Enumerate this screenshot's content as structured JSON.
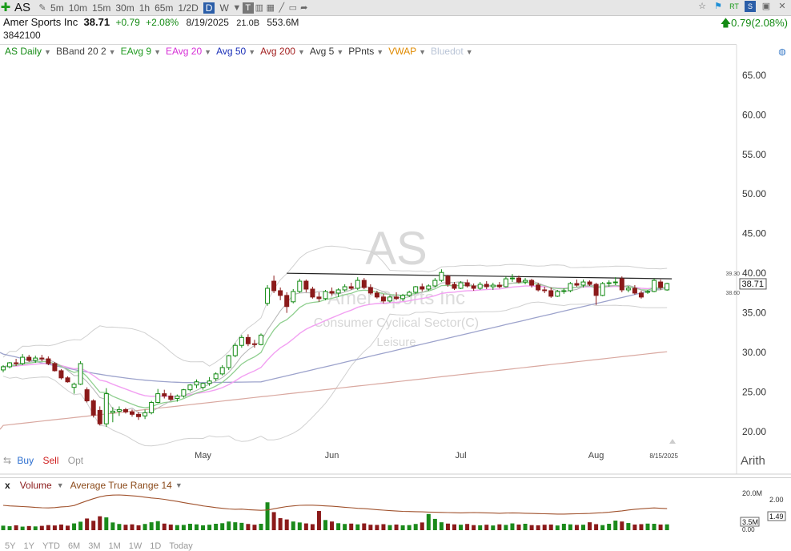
{
  "toolbar": {
    "ticker": "AS",
    "intervals": [
      "5m",
      "10m",
      "15m",
      "30m",
      "1h",
      "65m",
      "1/2D",
      "D",
      "W"
    ],
    "active_interval": "D"
  },
  "quote": {
    "name": "Amer Sports Inc",
    "price": "38.71",
    "change": "+0.79",
    "change_pct": "+2.08%",
    "date": "8/19/2025",
    "market_cap": "21.0B",
    "volume_avg": "553.6M",
    "volume": "3842100",
    "change_summary": "0.79(2.08%)"
  },
  "studies": [
    {
      "label": "AS Daily",
      "color": "#138a13"
    },
    {
      "label": "BBand 20 2",
      "color": "#444444"
    },
    {
      "label": "EAvg 9",
      "color": "#1f9a1f"
    },
    {
      "label": "EAvg 20",
      "color": "#d62fd6"
    },
    {
      "label": "Avg 50",
      "color": "#1a2fb8"
    },
    {
      "label": "Avg 200",
      "color": "#a32020"
    },
    {
      "label": "Avg 5",
      "color": "#333333"
    },
    {
      "label": "PPnts",
      "color": "#333333"
    },
    {
      "label": "VWAP",
      "color": "#e08a00"
    },
    {
      "label": "Bluedot",
      "color": "#b9c4d6"
    }
  ],
  "watermark": {
    "symbol": "AS",
    "name": "Amer Sports Inc",
    "sector": "Consumer Cyclical Sector(C)",
    "industry": "Leisure"
  },
  "trade": {
    "buy": "Buy",
    "sell": "Sell",
    "opt": "Opt"
  },
  "scale_mode": "Arith",
  "lower_pane": {
    "close": "x",
    "study1": "Volume",
    "study2": "Average True Range 14"
  },
  "bottom_labels": [
    "5Y",
    "1Y",
    "YTD",
    "6M",
    "3M",
    "1M",
    "1W",
    "1D",
    "Today"
  ],
  "colors": {
    "up": "#138a13",
    "down": "#8b1a1a"
  },
  "chart_data": {
    "type": "candlestick",
    "title": "AS Daily",
    "ylim": [
      19,
      67
    ],
    "y_ticks": [
      "65.00",
      "60.00",
      "55.00",
      "50.00",
      "45.00",
      "40.00",
      "35.00",
      "30.00",
      "25.00",
      "20.00"
    ],
    "x_labels": [
      "May",
      "Jun",
      "Jul",
      "Aug",
      "8/15/2025"
    ],
    "price_tag": "38.71",
    "price_tag_hi": "39.30",
    "price_tag_lo": "38.60",
    "resistance_line": [
      40.0,
      39.3
    ],
    "candles": [
      [
        27.8,
        28.4,
        27.5,
        28.2
      ],
      [
        28.2,
        28.8,
        28.0,
        28.7
      ],
      [
        28.7,
        29.2,
        28.3,
        28.6
      ],
      [
        28.6,
        29.8,
        28.4,
        29.4
      ],
      [
        29.4,
        29.7,
        28.8,
        29.0
      ],
      [
        29.0,
        29.6,
        28.7,
        29.3
      ],
      [
        29.3,
        29.7,
        28.9,
        29.2
      ],
      [
        29.2,
        29.5,
        28.4,
        28.6
      ],
      [
        28.6,
        28.8,
        27.6,
        27.7
      ],
      [
        27.7,
        27.9,
        26.6,
        26.8
      ],
      [
        26.8,
        27.0,
        26.2,
        26.3
      ],
      [
        25.6,
        26.2,
        24.8,
        26.0
      ],
      [
        26.0,
        28.9,
        25.9,
        28.6
      ],
      [
        25.3,
        25.6,
        23.7,
        23.9
      ],
      [
        23.9,
        24.1,
        21.8,
        22.1
      ],
      [
        22.7,
        23.2,
        20.8,
        21.0
      ],
      [
        21.0,
        25.5,
        20.6,
        24.8
      ],
      [
        22.4,
        23.1,
        21.2,
        22.6
      ],
      [
        22.6,
        23.2,
        22.0,
        22.8
      ],
      [
        22.8,
        23.0,
        22.3,
        22.5
      ],
      [
        22.5,
        22.8,
        21.9,
        22.2
      ],
      [
        22.2,
        22.5,
        21.5,
        21.9
      ],
      [
        22.0,
        22.8,
        21.6,
        22.4
      ],
      [
        22.4,
        23.9,
        22.2,
        23.7
      ],
      [
        23.7,
        25.4,
        23.6,
        24.8
      ],
      [
        24.8,
        25.3,
        24.2,
        24.5
      ],
      [
        24.5,
        24.9,
        23.9,
        24.1
      ],
      [
        24.2,
        24.7,
        23.8,
        24.5
      ],
      [
        24.5,
        25.4,
        24.3,
        25.3
      ],
      [
        25.3,
        26.0,
        25.1,
        25.9
      ],
      [
        25.9,
        26.6,
        25.5,
        26.3
      ],
      [
        25.6,
        26.2,
        25.3,
        26.1
      ],
      [
        26.1,
        26.9,
        25.8,
        26.4
      ],
      [
        26.7,
        27.5,
        26.4,
        27.3
      ],
      [
        27.3,
        28.4,
        27.1,
        28.1
      ],
      [
        28.1,
        29.7,
        27.8,
        29.6
      ],
      [
        29.6,
        31.2,
        29.4,
        30.9
      ],
      [
        30.9,
        32.2,
        30.6,
        31.9
      ],
      [
        31.9,
        32.3,
        30.8,
        31.1
      ],
      [
        31.1,
        31.6,
        30.6,
        31.0
      ],
      [
        31.0,
        32.4,
        30.9,
        32.2
      ],
      [
        36.2,
        38.5,
        35.9,
        38.1
      ],
      [
        39.0,
        39.7,
        37.5,
        37.8
      ],
      [
        37.8,
        38.2,
        36.6,
        37.2
      ],
      [
        37.2,
        37.6,
        35.0,
        35.8
      ],
      [
        36.4,
        38.0,
        36.2,
        37.7
      ],
      [
        37.7,
        39.3,
        37.5,
        39.0
      ],
      [
        39.0,
        39.2,
        37.6,
        38.0
      ],
      [
        38.0,
        38.3,
        36.8,
        37.0
      ],
      [
        37.0,
        37.6,
        36.4,
        36.8
      ],
      [
        36.8,
        37.9,
        36.6,
        37.7
      ],
      [
        37.7,
        38.2,
        37.2,
        37.5
      ],
      [
        37.5,
        38.1,
        37.0,
        37.9
      ],
      [
        37.9,
        38.6,
        37.7,
        38.3
      ],
      [
        38.3,
        38.8,
        37.9,
        38.1
      ],
      [
        38.1,
        39.5,
        37.9,
        39.1
      ],
      [
        39.1,
        39.4,
        38.0,
        38.2
      ],
      [
        38.2,
        38.6,
        37.3,
        37.5
      ],
      [
        37.5,
        37.8,
        36.8,
        37.0
      ],
      [
        37.0,
        37.4,
        36.2,
        36.5
      ],
      [
        36.5,
        37.2,
        36.3,
        37.0
      ],
      [
        37.0,
        37.6,
        36.6,
        36.8
      ],
      [
        36.8,
        37.4,
        36.5,
        37.2
      ],
      [
        37.2,
        37.8,
        37.0,
        37.6
      ],
      [
        37.6,
        38.4,
        37.4,
        38.3
      ],
      [
        38.3,
        38.7,
        37.7,
        38.0
      ],
      [
        38.0,
        38.6,
        37.8,
        38.4
      ],
      [
        38.4,
        39.4,
        38.2,
        39.1
      ],
      [
        39.1,
        40.5,
        38.9,
        40.1
      ],
      [
        39.6,
        39.8,
        38.3,
        38.6
      ],
      [
        38.6,
        38.9,
        37.9,
        38.1
      ],
      [
        38.1,
        39.0,
        38.0,
        38.8
      ],
      [
        38.8,
        39.2,
        38.2,
        38.4
      ],
      [
        38.4,
        38.7,
        37.8,
        38.1
      ],
      [
        38.1,
        38.9,
        37.9,
        38.6
      ],
      [
        38.6,
        39.0,
        38.0,
        38.3
      ],
      [
        38.3,
        38.8,
        37.9,
        38.5
      ],
      [
        38.5,
        38.9,
        38.1,
        38.3
      ],
      [
        38.3,
        39.6,
        38.2,
        39.3
      ],
      [
        39.3,
        39.9,
        38.9,
        39.4
      ],
      [
        39.4,
        39.7,
        38.7,
        38.9
      ],
      [
        38.9,
        39.4,
        38.6,
        39.1
      ],
      [
        39.1,
        39.3,
        38.2,
        38.5
      ],
      [
        38.5,
        38.8,
        37.7,
        37.9
      ],
      [
        37.9,
        38.3,
        37.5,
        37.8
      ],
      [
        37.8,
        38.2,
        36.9,
        37.1
      ],
      [
        37.1,
        37.9,
        37.0,
        37.7
      ],
      [
        37.7,
        38.1,
        37.4,
        37.8
      ],
      [
        37.8,
        38.9,
        37.6,
        38.7
      ],
      [
        38.7,
        39.2,
        38.3,
        38.5
      ],
      [
        38.5,
        39.2,
        38.2,
        38.9
      ],
      [
        38.9,
        39.1,
        38.4,
        38.6
      ],
      [
        38.6,
        38.8,
        36.0,
        37.2
      ],
      [
        37.2,
        38.9,
        37.1,
        38.7
      ],
      [
        38.7,
        39.1,
        38.3,
        38.8
      ],
      [
        38.8,
        39.5,
        38.5,
        38.9
      ],
      [
        39.3,
        39.6,
        37.6,
        37.9
      ],
      [
        37.9,
        38.4,
        37.6,
        38.1
      ],
      [
        38.1,
        38.5,
        37.3,
        37.5
      ],
      [
        37.5,
        37.8,
        36.8,
        37.0
      ],
      [
        37.6,
        37.9,
        37.4,
        37.7
      ],
      [
        37.7,
        39.3,
        37.6,
        39.1
      ],
      [
        38.9,
        39.2,
        37.9,
        38.2
      ],
      [
        37.9,
        38.8,
        37.8,
        38.7
      ]
    ],
    "volume": [
      2.4,
      2.1,
      2.6,
      1.9,
      2.2,
      2.0,
      2.3,
      2.7,
      2.5,
      3.0,
      2.4,
      3.6,
      4.5,
      6.2,
      5.0,
      7.4,
      6.8,
      4.1,
      3.3,
      2.9,
      3.1,
      2.6,
      3.3,
      4.2,
      4.8,
      3.5,
      3.0,
      2.7,
      2.8,
      3.4,
      3.1,
      2.6,
      2.9,
      3.4,
      3.7,
      4.6,
      4.2,
      3.9,
      3.3,
      2.9,
      3.4,
      14.8,
      9.6,
      6.4,
      5.7,
      4.6,
      4.1,
      3.6,
      3.2,
      10.2,
      5.4,
      4.6,
      3.7,
      3.3,
      3.5,
      3.1,
      3.6,
      2.9,
      2.8,
      3.2,
      2.7,
      3.0,
      2.6,
      2.7,
      3.3,
      4.1,
      8.6,
      6.0,
      4.2,
      3.5,
      3.1,
      2.9,
      3.3,
      2.7,
      2.6,
      2.9,
      2.5,
      3.1,
      2.8,
      3.6,
      3.0,
      3.4,
      2.7,
      2.6,
      2.9,
      3.0,
      2.5,
      3.4,
      3.1,
      2.8,
      2.9,
      4.2,
      3.2,
      2.7,
      3.4,
      5.1,
      4.6,
      3.8,
      3.0,
      3.2,
      3.5,
      3.4,
      3.0,
      3.1
    ],
    "atr": [
      1.45,
      1.42,
      1.4,
      1.38,
      1.36,
      1.33,
      1.31,
      1.3,
      1.32,
      1.36,
      1.38,
      1.44,
      1.58,
      1.72,
      1.84,
      1.95,
      2.02,
      2.05,
      2.06,
      2.04,
      2.01,
      1.98,
      1.93,
      1.88,
      1.85,
      1.8,
      1.74,
      1.68,
      1.61,
      1.55,
      1.49,
      1.42,
      1.37,
      1.32,
      1.28,
      1.24,
      1.22,
      1.23,
      1.2,
      1.18,
      1.16,
      1.18,
      1.25,
      1.32,
      1.38,
      1.42,
      1.45,
      1.46,
      1.46,
      1.44,
      1.42,
      1.4,
      1.37,
      1.34,
      1.31,
      1.28,
      1.26,
      1.23,
      1.2,
      1.17,
      1.14,
      1.12,
      1.1,
      1.09,
      1.08,
      1.07,
      1.06,
      1.05,
      1.04,
      1.03,
      1.02,
      1.01,
      1.02,
      1.03,
      1.02,
      1.01,
      1.0,
      0.99,
      1.0,
      1.01,
      1.0,
      0.99,
      0.98,
      0.97,
      0.96,
      0.95,
      0.94,
      0.94,
      0.95,
      0.96,
      0.97,
      0.98,
      1.0,
      1.02,
      1.05,
      1.09,
      1.13,
      1.18,
      1.22,
      1.25,
      1.28,
      1.3,
      1.28,
      1.26
    ],
    "vol_axis": [
      "20.0M",
      "3.5M"
    ],
    "atr_axis": [
      "2.00",
      "1.49",
      "0.00"
    ]
  }
}
